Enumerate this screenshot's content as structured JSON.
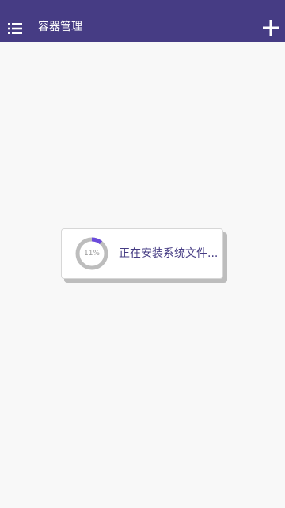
{
  "app_bar": {
    "title": "容器管理",
    "menu_icon": "list-menu-icon",
    "add_icon": "plus-icon",
    "background_color": "#463c84"
  },
  "dialog": {
    "progress_percent": 11,
    "progress_label": "11%",
    "status_text": "正在安装系统文件...",
    "accent_color": "#6b4bdc",
    "track_color": "#bdbdbd"
  }
}
